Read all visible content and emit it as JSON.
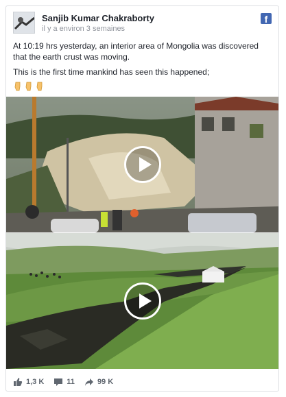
{
  "post": {
    "author": "Sanjib Kumar Chakraborty",
    "timestamp": "il y a environ 3 semaines",
    "paragraph1": "At 10:19 hrs yesterday, an interior area of Mongolia was discovered that the earth crust was moving.",
    "paragraph2": "This is the first time mankind has seen this happened;",
    "emojis": [
      "point-down-emoji",
      "point-down-emoji",
      "point-down-emoji"
    ]
  },
  "stats": {
    "likes": "1,3 K",
    "comments": "11",
    "shares": "99 K"
  },
  "colors": {
    "facebook_blue": "#4267b2",
    "text": "#1d2129",
    "muted": "#90949c"
  }
}
